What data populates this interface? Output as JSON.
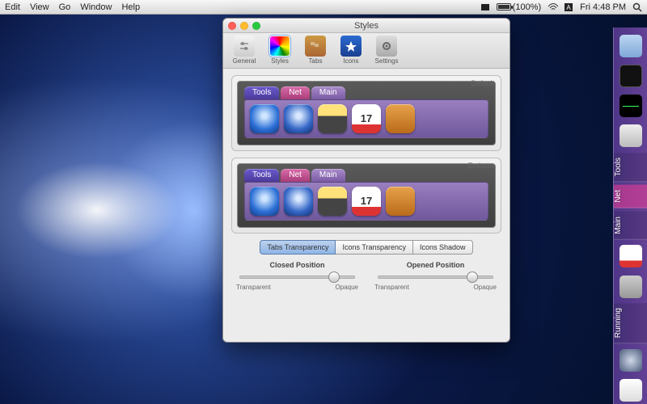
{
  "menubar": {
    "items": [
      "Edit",
      "View",
      "Go",
      "Window",
      "Help"
    ],
    "battery_pct": "(100%)",
    "clock": "Fri 4:48 PM"
  },
  "window": {
    "title": "Styles",
    "toolbar": {
      "general": "General",
      "styles": "Styles",
      "tabs": "Tabs",
      "icons": "Icons",
      "settings": "Settings"
    },
    "style_cards": {
      "a_name": "Default",
      "b_name": "Emboss",
      "pv_tabs": {
        "tools": "Tools",
        "net": "Net",
        "main": "Main"
      },
      "ical_day": "17"
    },
    "segmented": {
      "a": "Tabs Transparency",
      "b": "Icons Transparency",
      "c": "Icons Shadow"
    },
    "sliders": {
      "closed_hdr": "Closed Position",
      "opened_hdr": "Opened Position",
      "left_label": "Transparent",
      "right_label": "Opaque",
      "closed_val": 82,
      "opened_val": 82
    }
  },
  "sidedock": {
    "tabs": {
      "tools": "Tools",
      "net": "Net",
      "main": "Main",
      "running": "Running"
    }
  }
}
